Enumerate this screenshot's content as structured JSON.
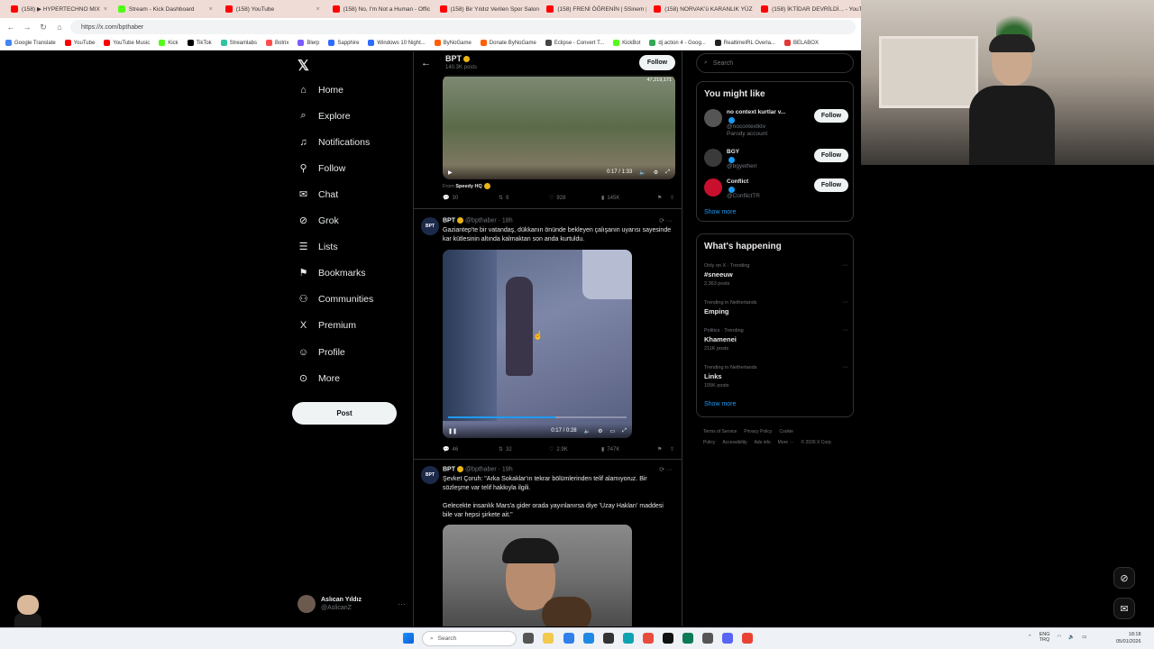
{
  "browser": {
    "tabs": [
      {
        "label": "(158) ▶ HYPERTECHNO MIX",
        "color": "#ff0000",
        "active": false
      },
      {
        "label": "Stream - Kick Dashboard",
        "color": "#53fc18",
        "active": false
      },
      {
        "label": "(158) YouTube",
        "color": "#ff0000",
        "active": false
      },
      {
        "label": "(158) No, I'm Not a Human - Offic",
        "color": "#ff0000",
        "active": false
      },
      {
        "label": "(158) Bir Yıldız Verilen Spor Salonl",
        "color": "#ff0000",
        "active": false
      },
      {
        "label": "(158) FRENİ ÖĞRENİN | 5Sinem |",
        "color": "#ff0000",
        "active": false
      },
      {
        "label": "(158) NORVAK'ü KARANLIK YÜZ",
        "color": "#ff0000",
        "active": false
      },
      {
        "label": "(158) İKTİDAR DEVRİLDİ... - YouT",
        "color": "#ff0000",
        "active": false
      }
    ],
    "url": "https://x.com/bpthaber",
    "bookmarks": [
      {
        "label": "Google Translate",
        "color": "#4285f4"
      },
      {
        "label": "YouTube",
        "color": "#ff0000"
      },
      {
        "label": "YouTube Music",
        "color": "#ff0000"
      },
      {
        "label": "Kick",
        "color": "#53fc18"
      },
      {
        "label": "TikTok",
        "color": "#000000"
      },
      {
        "label": "Streamlabs",
        "color": "#31c3a2"
      },
      {
        "label": "Botrix",
        "color": "#ff4d4d"
      },
      {
        "label": "Blerp",
        "color": "#7a5cff"
      },
      {
        "label": "Sapphire",
        "color": "#2f6bff"
      },
      {
        "label": "Windows 10 Night...",
        "color": "#2f6bff"
      },
      {
        "label": "ByNoGame",
        "color": "#ff5f00"
      },
      {
        "label": "Donate ByNoGame",
        "color": "#ff5f00"
      },
      {
        "label": "Eclipse - Convert T...",
        "color": "#444444"
      },
      {
        "label": "KickBot",
        "color": "#53fc18"
      },
      {
        "label": "dj action 4 - Goog...",
        "color": "#34a853"
      },
      {
        "label": "RealtimeIRL Overla...",
        "color": "#222222"
      },
      {
        "label": "BELABOX",
        "color": "#e53935"
      }
    ]
  },
  "nav": {
    "items": [
      {
        "label": "Home",
        "icon": "home-icon",
        "glyph": "⌂"
      },
      {
        "label": "Explore",
        "icon": "search-icon",
        "glyph": "⌕"
      },
      {
        "label": "Notifications",
        "icon": "bell-icon",
        "glyph": "♫"
      },
      {
        "label": "Follow",
        "icon": "person-add-icon",
        "glyph": "⚲"
      },
      {
        "label": "Chat",
        "icon": "mail-icon",
        "glyph": "✉"
      },
      {
        "label": "Grok",
        "icon": "grok-icon",
        "glyph": "⊘"
      },
      {
        "label": "Lists",
        "icon": "list-icon",
        "glyph": "☰"
      },
      {
        "label": "Bookmarks",
        "icon": "bookmark-icon",
        "glyph": "⚑"
      },
      {
        "label": "Communities",
        "icon": "people-icon",
        "glyph": "⚇"
      },
      {
        "label": "Premium",
        "icon": "x-logo-icon",
        "glyph": "X"
      },
      {
        "label": "Profile",
        "icon": "user-icon",
        "glyph": "☺"
      },
      {
        "label": "More",
        "icon": "more-circle-icon",
        "glyph": "⊙"
      }
    ],
    "post_label": "Post",
    "account": {
      "name": "Aslıcan Yıldız",
      "handle": "@AslicanZ"
    }
  },
  "timeline": {
    "header": {
      "name": "BPT",
      "posts": "140.3K posts",
      "follow_label": "Follow"
    },
    "video1": {
      "counter": "47,219,171",
      "time": "0:17 / 1:33",
      "from_prefix": "From",
      "from_name": "Speedy HQ"
    },
    "actions1": {
      "replies": "30",
      "reposts": "9",
      "likes": "928",
      "views": "145K"
    },
    "tweet2": {
      "name": "BPT",
      "meta": "@bpthaber · 18h",
      "text": "Gaziantep'te bir vatandaş, dükkanın önünde bekleyen çalışanın uyarısı sayesinde kar kütlesinin altında kalmaktan son anda kurtuldu.",
      "video_time": "0:17 / 0:28",
      "progress": 0.6,
      "replies": "46",
      "reposts": "32",
      "likes": "2.9K",
      "views": "747K"
    },
    "tweet3": {
      "name": "BPT",
      "meta": "@bpthaber · 19h",
      "text1": "Şevket Çoruh: \"Arka Sokaklar'ın tekrar bölümlerinden telif alamıyoruz. Bir sözleşme var telif hakkıyla ilgili.",
      "text2": "Gelecekte insanlık Mars'a gider orada yayınlanırsa diye 'Uzay Hakları' maddesi bile var hepsi şirkete ait.\""
    }
  },
  "sidebar": {
    "search_placeholder": "Search",
    "might_like": {
      "title": "You might like",
      "suggestions": [
        {
          "name": "no context kurtlar v...",
          "handle": "@nocontextktv",
          "extra": "Parody account",
          "follow": "Follow",
          "color": "#555555"
        },
        {
          "name": "BGY",
          "handle": "@bgyetherr",
          "extra": "",
          "follow": "Follow",
          "color": "#3a3a3a"
        },
        {
          "name": "Conflict",
          "handle": "@ConflictTR",
          "extra": "",
          "follow": "Follow",
          "color": "#c8102e"
        }
      ],
      "show_more": "Show more"
    },
    "happening": {
      "title": "What's happening",
      "trends": [
        {
          "context": "Only on X · Trending",
          "name": "#sneeuw",
          "count": "2,363 posts"
        },
        {
          "context": "Trending in Netherlands",
          "name": "Emping",
          "count": ""
        },
        {
          "context": "Politics · Trending",
          "name": "Khamenei",
          "count": "211K posts"
        },
        {
          "context": "Trending in Netherlands",
          "name": "Links",
          "count": "105K posts"
        }
      ],
      "show_more": "Show more"
    },
    "footer": [
      "Terms of Service",
      "Privacy Policy",
      "Cookie Policy",
      "Accessibility",
      "Ads info",
      "More ···",
      "© 2026 X Corp."
    ]
  },
  "taskbar": {
    "search_placeholder": "Search",
    "lang": "ENG",
    "region": "TRQ",
    "time": "18:18",
    "date": "05/01/2026"
  }
}
